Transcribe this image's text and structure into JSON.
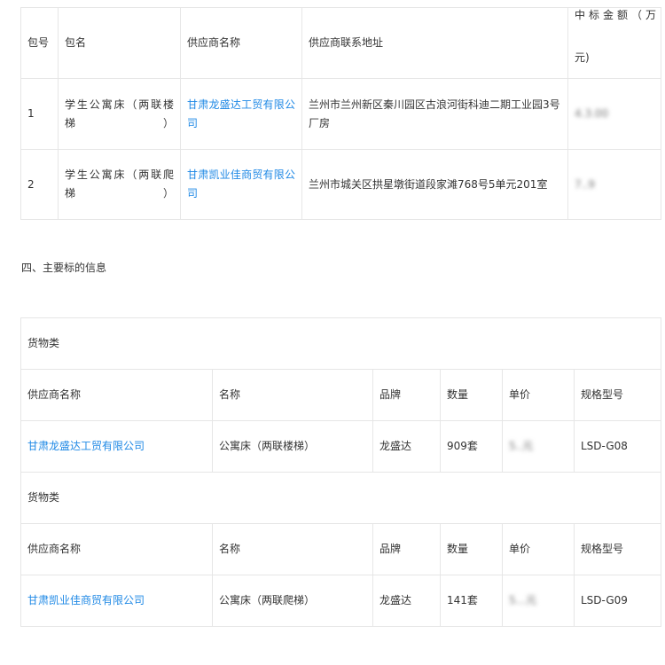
{
  "bidders_table": {
    "headers": {
      "package_no": "包号",
      "package_name": "包名",
      "supplier_name": "供应商名称",
      "supplier_address": "供应商联系地址",
      "amount_part1": "中标金额（万",
      "amount_part2": "元)"
    },
    "rows": [
      {
        "package_no": "1",
        "package_name": "学生公寓床（两联楼梯）",
        "supplier_name": "甘肃龙盛达工贸有限公司",
        "supplier_address": "兰州市兰州新区秦川园区古浪河街科迪二期工业园3号厂房",
        "amount": "4.3.00"
      },
      {
        "package_no": "2",
        "package_name": "学生公寓床（两联爬梯）",
        "supplier_name": "甘肃凯业佳商贸有限公司",
        "supplier_address": "兰州市城关区拱星墩街道段家滩768号5单元201室",
        "amount": "7..9"
      }
    ]
  },
  "section4_title": "四、主要标的信息",
  "goods_tables": [
    {
      "category": "货物类",
      "headers": {
        "supplier": "供应商名称",
        "name": "名称",
        "brand": "品牌",
        "quantity": "数量",
        "unit_price": "单价",
        "model": "规格型号"
      },
      "row": {
        "supplier": "甘肃龙盛达工贸有限公司",
        "name": "公寓床（两联楼梯）",
        "brand": "龙盛达",
        "quantity": "909套",
        "unit_price": "5..元",
        "model": "LSD-G08"
      }
    },
    {
      "category": "货物类",
      "headers": {
        "supplier": "供应商名称",
        "name": "名称",
        "brand": "品牌",
        "quantity": "数量",
        "unit_price": "单价",
        "model": "规格型号"
      },
      "row": {
        "supplier": "甘肃凯业佳商贸有限公司",
        "name": "公寓床（两联爬梯）",
        "brand": "龙盛达",
        "quantity": "141套",
        "unit_price": "5...元",
        "model": "LSD-G09"
      }
    }
  ],
  "colors": {
    "link": "#1e88e5",
    "border": "#e6e6e6",
    "text": "#333333"
  }
}
